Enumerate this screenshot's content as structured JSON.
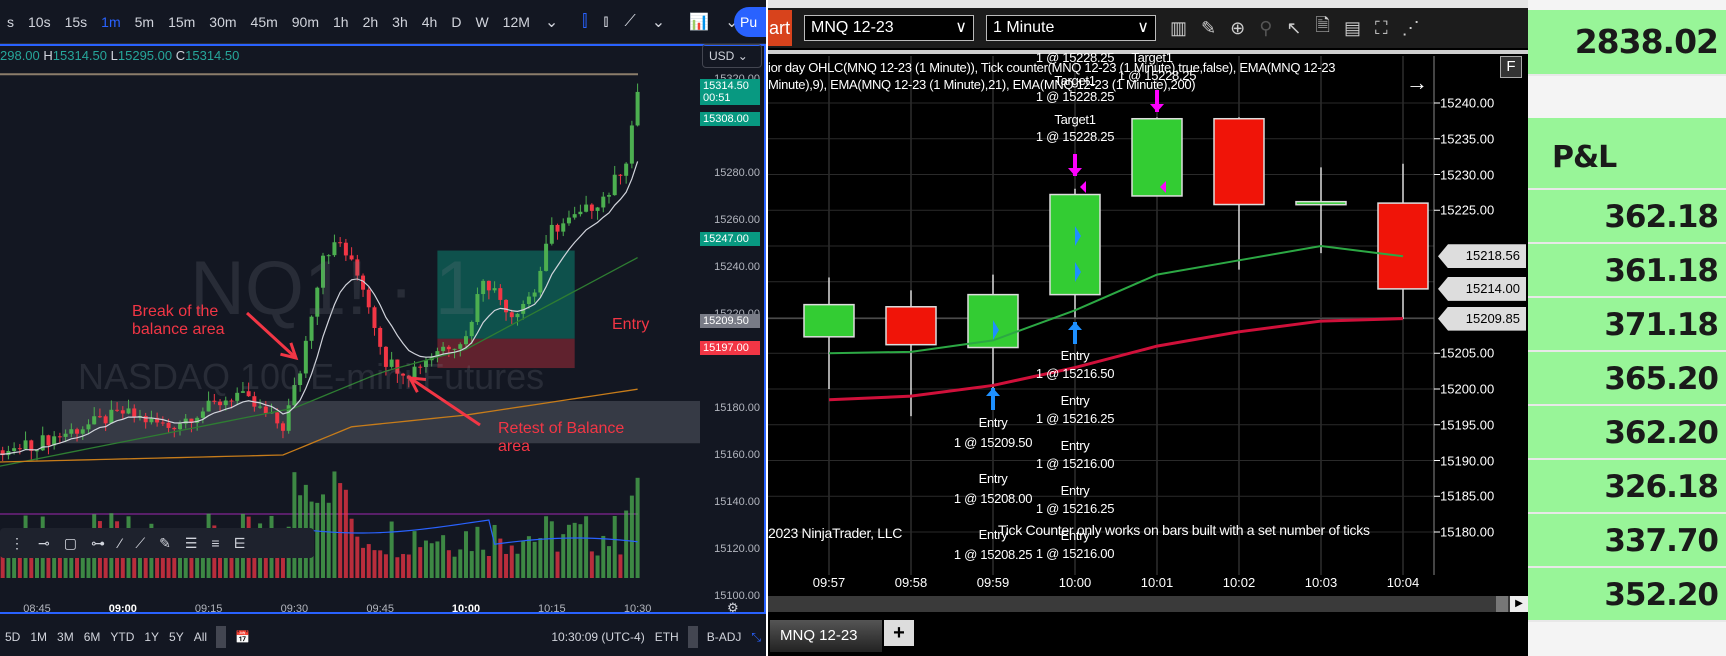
{
  "tradingview": {
    "timeframes": [
      "s",
      "10s",
      "15s",
      "1m",
      "5m",
      "15m",
      "30m",
      "45m",
      "90m",
      "1h",
      "2h",
      "3h",
      "4h",
      "D",
      "W",
      "12M"
    ],
    "active_timeframe": "1m",
    "publish_label": "Pu",
    "ohlc": {
      "o": "298.00",
      "h_label": "H",
      "h": "15314.50",
      "l_label": "L",
      "l": "15295.00",
      "c_label": "C",
      "c": "15314.50"
    },
    "currency": "USD",
    "watermark_symbol": "NQ1! · 1",
    "watermark_name": "NASDAQ 100 E-mini Futures",
    "price_ticks": [
      "15320.00",
      "15280.00",
      "15260.00",
      "15240.00",
      "15220.00",
      "15180.00",
      "15160.00",
      "15140.00",
      "15120.00",
      "15100.00"
    ],
    "price_tags": {
      "last": "15314.50",
      "countdown": "00:51",
      "p1": "15308.00",
      "target": "15247.00",
      "entry": "15209.50",
      "stop": "15197.00"
    },
    "annotations": {
      "break": "Break of the balance area",
      "retest": "Retest of Balance area",
      "entry": "Entry"
    },
    "time_ticks": [
      "08:45",
      "09:00",
      "09:15",
      "09:30",
      "09:45",
      "10:00",
      "10:15",
      "10:30"
    ],
    "ranges": [
      "5D",
      "1M",
      "3M",
      "6M",
      "YTD",
      "1Y",
      "5Y",
      "All"
    ],
    "clock": "10:30:09 (UTC-4)",
    "session": "ETH",
    "adjust": "B-ADJ",
    "colors": {
      "up": "#26a69a",
      "down": "#f23645",
      "candle_up": "#4caf50",
      "accent": "#2962ff"
    },
    "chart_data": {
      "type": "candlestick",
      "close_keypoints": [
        [
          "08:38",
          15160
        ],
        [
          "08:45",
          15165
        ],
        [
          "09:00",
          15178
        ],
        [
          "09:08",
          15172
        ],
        [
          "09:20",
          15186
        ],
        [
          "09:28",
          15172
        ],
        [
          "09:31",
          15196
        ],
        [
          "09:35",
          15246
        ],
        [
          "09:38",
          15250
        ],
        [
          "09:42",
          15232
        ],
        [
          "09:46",
          15200
        ],
        [
          "09:50",
          15195
        ],
        [
          "09:55",
          15205
        ],
        [
          "10:00",
          15210
        ],
        [
          "10:03",
          15236
        ],
        [
          "10:08",
          15220
        ],
        [
          "10:12",
          15230
        ],
        [
          "10:15",
          15256
        ],
        [
          "10:20",
          15262
        ],
        [
          "10:25",
          15272
        ],
        [
          "10:28",
          15286
        ],
        [
          "10:30",
          15314.5
        ]
      ],
      "ema_slow_keypoints": [
        [
          "08:38",
          15155
        ],
        [
          "09:30",
          15180
        ],
        [
          "09:45",
          15195
        ],
        [
          "10:00",
          15205
        ],
        [
          "10:30",
          15244
        ]
      ],
      "ema_200_keypoints": [
        [
          "08:38",
          15157
        ],
        [
          "09:28",
          15160
        ],
        [
          "09:40",
          15172
        ],
        [
          "10:00",
          15177
        ],
        [
          "10:30",
          15188
        ]
      ],
      "balance_zone": [
        15165,
        15183
      ],
      "position": {
        "start": "09:55",
        "end": "10:19",
        "entry": 15209.5,
        "target": 15247,
        "stop": 15197
      },
      "prior_high": 15322
    }
  },
  "ninjatrader": {
    "chart_button": "art",
    "instrument": "MNQ 12-23",
    "interval": "1 Minute",
    "indicators_line1": "ior day OHLC(MNQ 12-23 (1 Minute)), Tick counter(MNQ 12-23 (1 Minute),true,false), EMA(MNQ 12-23",
    "indicators_line2": "Minute),9), EMA(MNQ 12-23 (1 Minute),21), EMA(MNQ 12-23 (1 Minute),200)",
    "f_button": "F",
    "copyright": "2023 NinjaTrader, LLC",
    "tick_note": "Tick Counter only works on bars built with a set number of ticks",
    "targets": [
      {
        "label": "Target1",
        "price": "1 @ 15228.25"
      },
      {
        "label": "Target1",
        "price": "1 @ 15228.25"
      },
      {
        "label": "Target1",
        "price": "1 @ 15228.25"
      }
    ],
    "entries_0959": [
      {
        "label": "Entry",
        "price": "1 @ 15209.50"
      },
      {
        "label": "Entry",
        "price": "1 @ 15208.00"
      },
      {
        "label": "Entry",
        "price": "1 @ 15208.25"
      }
    ],
    "entries_1000": [
      {
        "label": "Entry",
        "price": "1 @ 15216.50"
      },
      {
        "label": "Entry",
        "price": "1 @ 15216.25"
      },
      {
        "label": "Entry",
        "price": "1 @ 15216.00"
      },
      {
        "label": "Entry",
        "price": "1 @ 15216.25"
      },
      {
        "label": "Entry",
        "price": "1 @ 15216.00"
      }
    ],
    "price_ticks": [
      "15240.00",
      "15235.00",
      "15230.00",
      "15225.00",
      "15205.00",
      "15200.00",
      "15195.00",
      "15190.00",
      "15185.00",
      "15180.00"
    ],
    "price_tags": [
      "15218.56",
      "15214.00",
      "15209.85"
    ],
    "tab": "MNQ 12-23",
    "add_tab": "+",
    "chart_data": {
      "type": "candlestick",
      "x": [
        "09:57",
        "09:58",
        "09:59",
        "10:00",
        "10:01",
        "10:02",
        "10:03",
        "10:04"
      ],
      "open": [
        15207.3,
        15211.5,
        15205.8,
        15213.2,
        15227,
        15237.8,
        15225.8,
        15226
      ],
      "high": [
        15215.6,
        15213.8,
        15216,
        15228,
        15238,
        15238,
        15231,
        15231.5
      ],
      "low": [
        15200,
        15196.2,
        15199.7,
        15210,
        15227,
        15216.7,
        15219,
        15209.8
      ],
      "close": [
        15211.8,
        15206.2,
        15213.2,
        15227.2,
        15237.8,
        15225.8,
        15226.2,
        15214
      ],
      "ema21": [
        15205,
        15205.2,
        15206.8,
        15211,
        15216,
        15218,
        15220,
        15218.56
      ],
      "ema200": [
        15198.5,
        15199,
        15200.5,
        15203,
        15206,
        15208,
        15209.5,
        15209.85
      ],
      "ylim": [
        15178,
        15246
      ]
    }
  },
  "pnl": {
    "total": "2838.02",
    "header": "P&L",
    "rows": [
      "362.18",
      "361.18",
      "371.18",
      "365.20",
      "362.20",
      "326.18",
      "337.70",
      "352.20"
    ]
  }
}
